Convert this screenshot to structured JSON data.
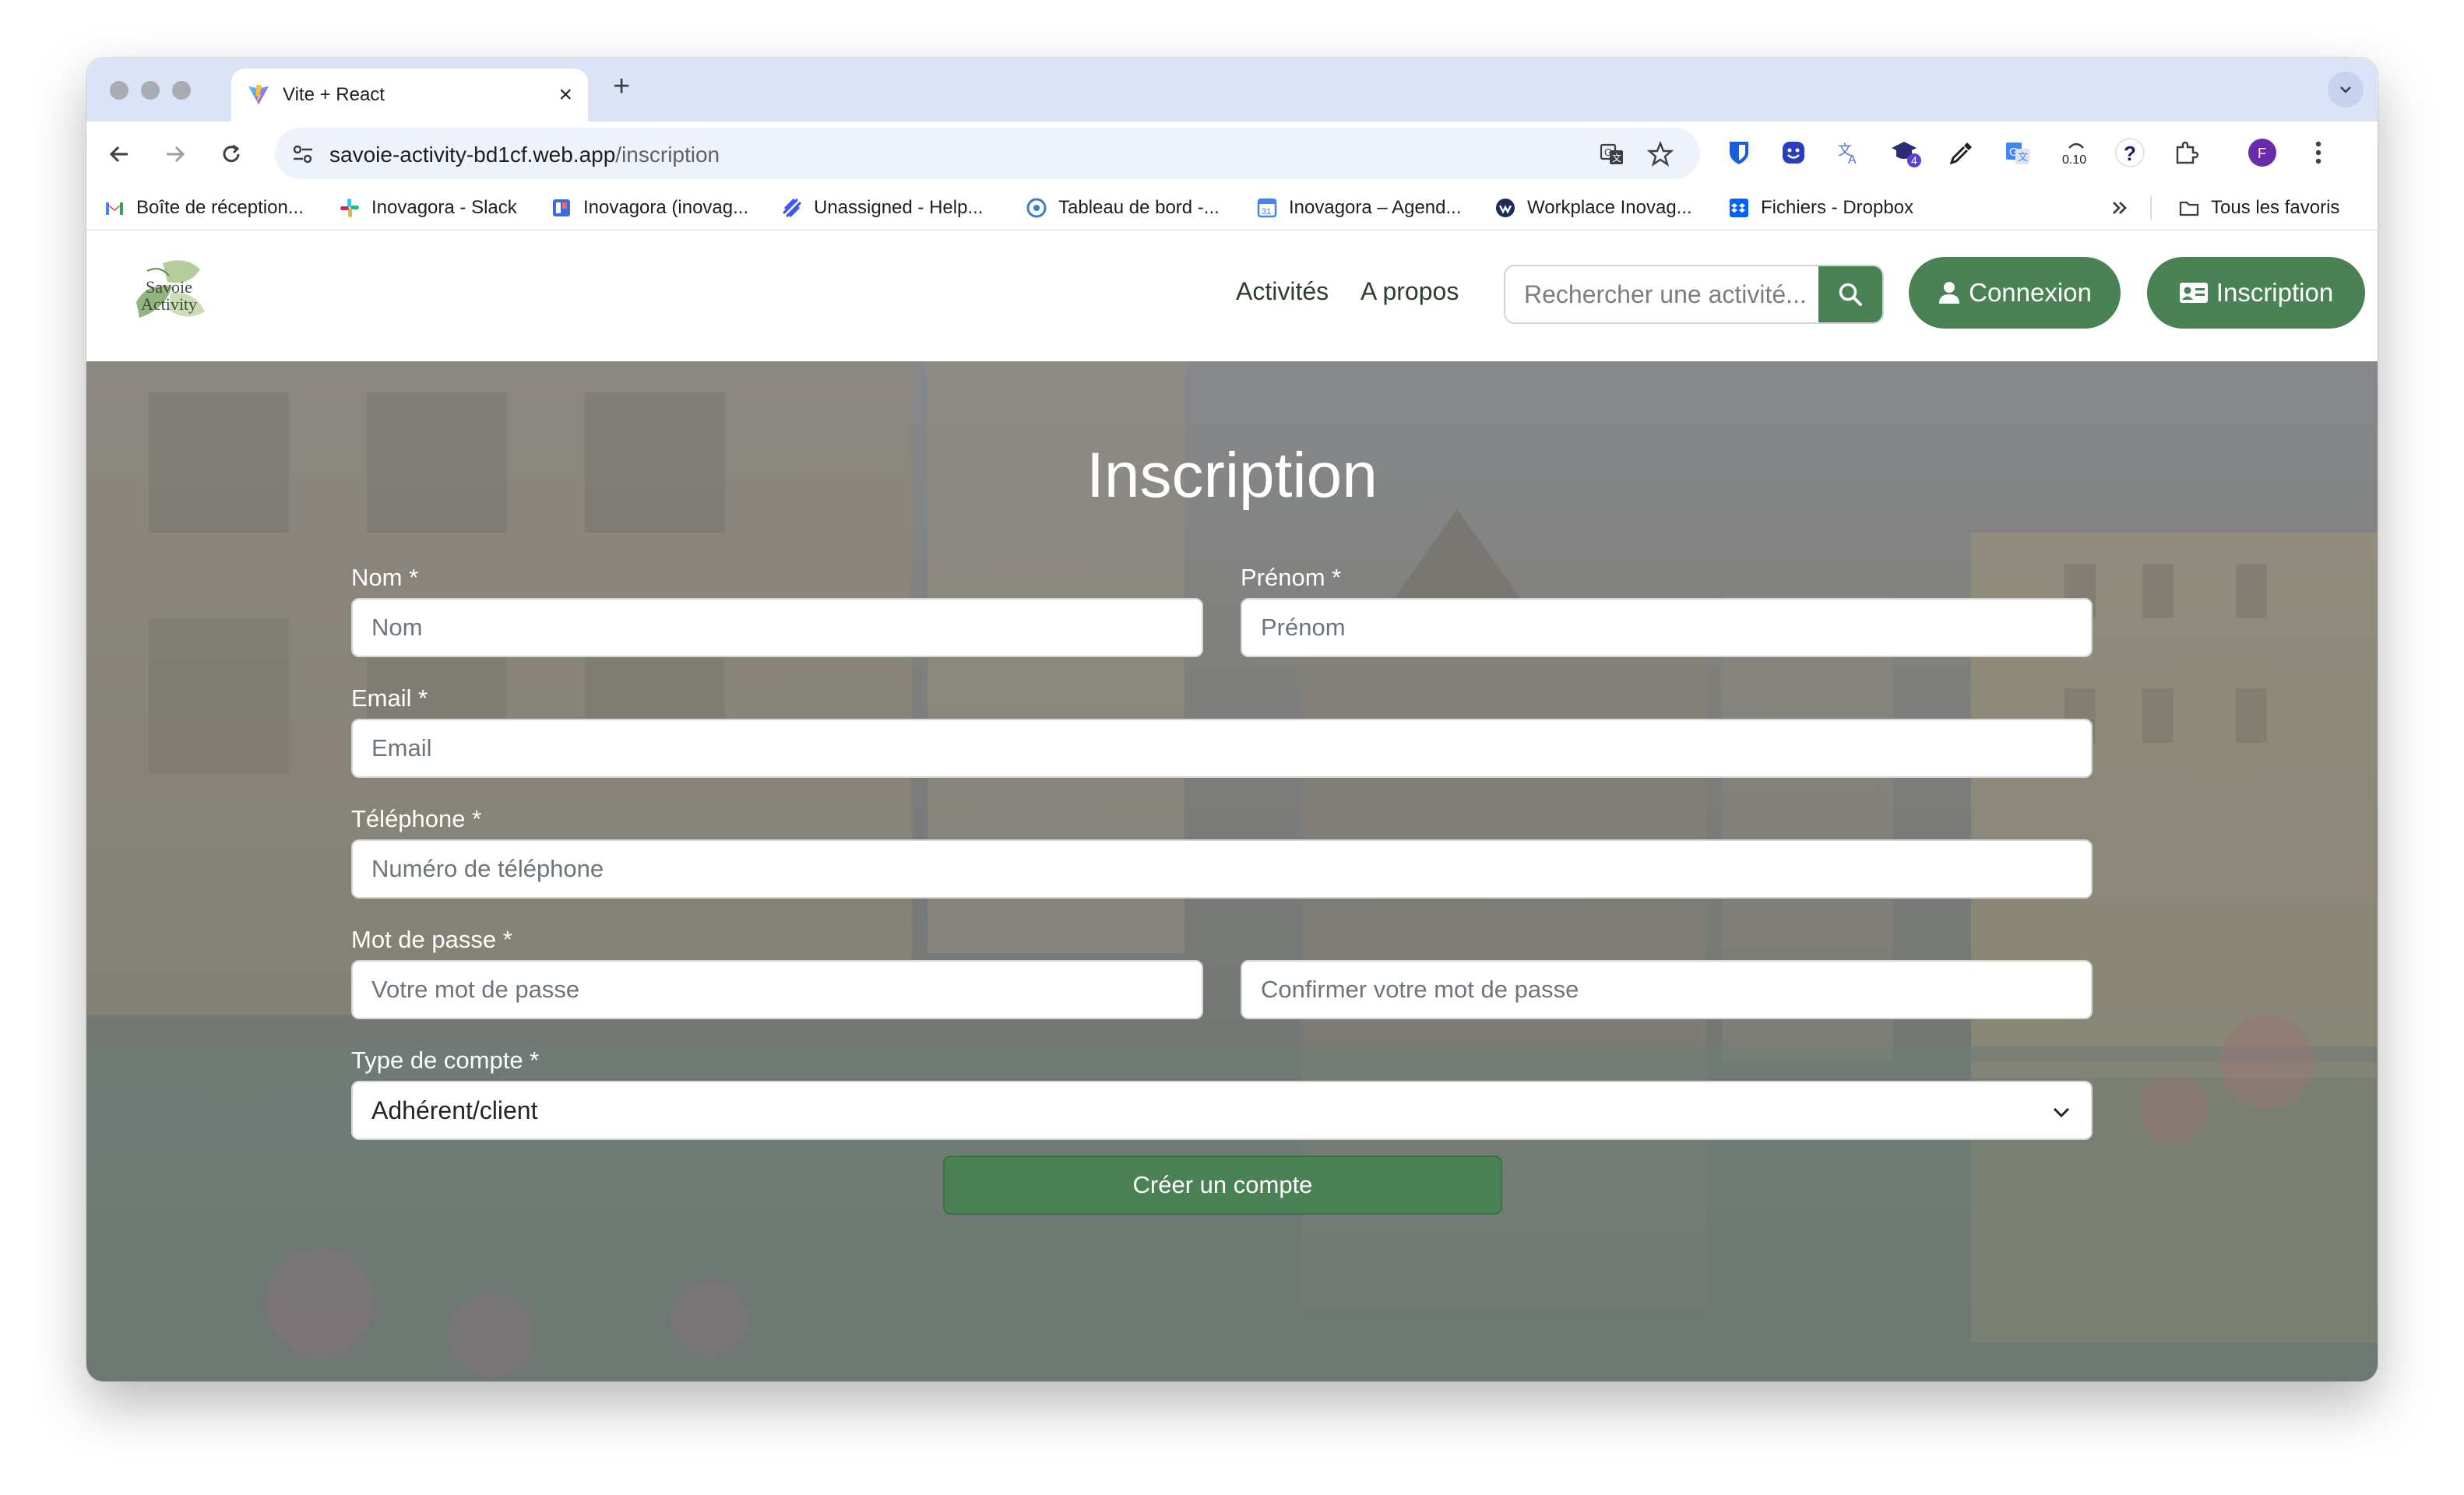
{
  "browser": {
    "tab_title": "Vite + React",
    "url_domain": "savoie-activity-bd1cf.web.app",
    "url_path": "/inscription",
    "extension_badge": "4",
    "extension_counter": "0.10",
    "profile_initial": "F",
    "bookmarks": [
      {
        "label": "Boîte de réception...",
        "icon": "gmail-icon",
        "color": "#ea4335"
      },
      {
        "label": "Inovagora - Slack",
        "icon": "slack-icon",
        "color": "#e01e5a"
      },
      {
        "label": "Inovagora (inovag...",
        "icon": "board-icon",
        "color": "#3d6bd8"
      },
      {
        "label": "Unassigned - Help...",
        "icon": "helpscout-icon",
        "color": "#3d5af1"
      },
      {
        "label": "Tableau de bord -...",
        "icon": "dashboard-icon",
        "color": "#3a7bd5"
      },
      {
        "label": "Inovagora – Agend...",
        "icon": "calendar-icon",
        "color": "#4285f4"
      },
      {
        "label": "Workplace Inovag...",
        "icon": "workplace-icon",
        "color": "#1c2b5a"
      },
      {
        "label": "Fichiers - Dropbox",
        "icon": "dropbox-icon",
        "color": "#0061fe"
      }
    ],
    "all_bookmarks_label": "Tous les favoris"
  },
  "nav": {
    "logo_text_line1": "Savoie",
    "logo_text_line2": "Activity",
    "links": [
      "Activités",
      "A propos"
    ],
    "search_placeholder": "Rechercher une activité...",
    "login_label": "Connexion",
    "signup_label": "Inscription"
  },
  "form": {
    "title": "Inscription",
    "last_name_label": "Nom *",
    "last_name_placeholder": "Nom",
    "first_name_label": "Prénom *",
    "first_name_placeholder": "Prénom",
    "email_label": "Email *",
    "email_placeholder": "Email",
    "phone_label": "Téléphone *",
    "phone_placeholder": "Numéro de téléphone",
    "password_label": "Mot de passe *",
    "password_placeholder": "Votre mot de passe",
    "confirm_placeholder": "Confirmer votre mot de passe",
    "account_type_label": "Type de compte *",
    "account_type_value": "Adhérent/client",
    "submit_label": "Créer un compte"
  },
  "colors": {
    "brand_green": "#4a8255",
    "tab_strip": "#dbe4f7"
  }
}
